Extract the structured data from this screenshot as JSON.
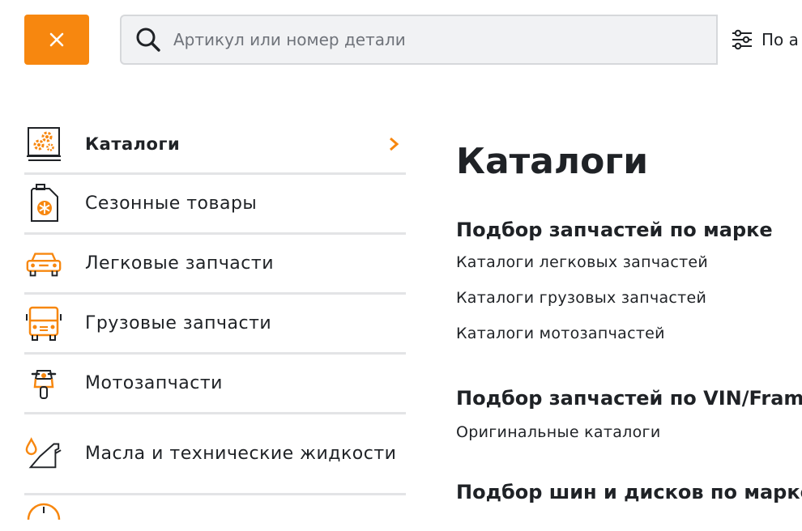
{
  "header": {
    "search": {
      "placeholder": "Артикул или номер детали",
      "value": ""
    },
    "filter_label": "По а"
  },
  "sidebar": {
    "items": [
      {
        "label": "Каталоги",
        "active": true,
        "icon": "catalog-book-gears-icon"
      },
      {
        "label": "Сезонные товары",
        "active": false,
        "icon": "canister-snowflake-icon"
      },
      {
        "label": "Легковые запчасти",
        "active": false,
        "icon": "car-icon"
      },
      {
        "label": "Грузовые запчасти",
        "active": false,
        "icon": "truck-icon"
      },
      {
        "label": "Мотозапчасти",
        "active": false,
        "icon": "motorcycle-icon"
      },
      {
        "label": "Масла и технические жидкости",
        "active": false,
        "icon": "oil-can-icon"
      }
    ]
  },
  "main": {
    "title": "Каталоги",
    "sections": [
      {
        "heading": "Подбор запчастей по марке",
        "links": [
          "Каталоги легковых запчастей",
          "Каталоги грузовых запчастей",
          "Каталоги мотозапчастей"
        ]
      },
      {
        "heading": "Подбор запчастей по VIN/Frame",
        "links": [
          "Оригинальные каталоги"
        ]
      },
      {
        "heading": "Подбор шин и дисков по марке",
        "links": []
      }
    ]
  },
  "colors": {
    "accent": "#f7870f",
    "text": "#1f2226",
    "border": "#e3e4e6",
    "search_bg": "#f1f2f4"
  }
}
